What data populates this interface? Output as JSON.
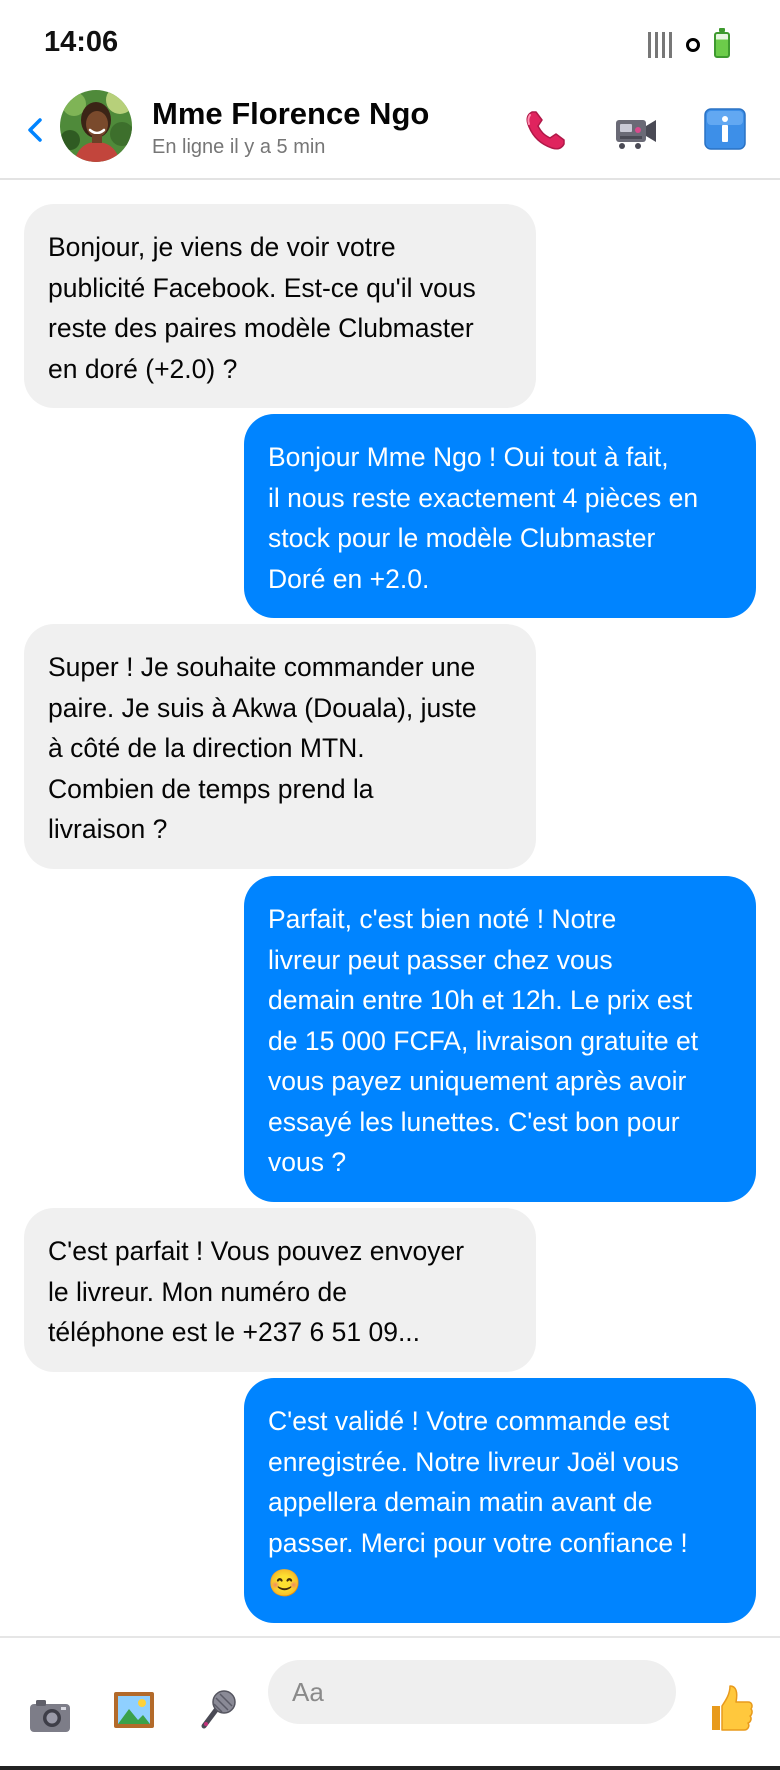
{
  "status_bar": {
    "time": "14:06",
    "icons": [
      "signal-icon",
      "wifi-icon",
      "battery-icon"
    ]
  },
  "header": {
    "back_icon": "chevron-left-icon",
    "contact_name": "Mme Florence Ngo",
    "presence": "En ligne il y a 5 min",
    "actions": [
      "phone-icon",
      "video-camera-icon",
      "info-icon"
    ]
  },
  "messages": [
    {
      "direction": "incoming",
      "text": "Bonjour, je viens de voir votre\npublicité Facebook. Est-ce qu'il vous\nreste des paires modèle Clubmaster\nen doré (+2.0) ?"
    },
    {
      "direction": "outgoing",
      "text": "Bonjour Mme Ngo ! Oui tout à fait,\nil nous reste exactement 4 pièces en\nstock pour le modèle Clubmaster\nDoré en +2.0."
    },
    {
      "direction": "incoming",
      "text": "Super ! Je souhaite commander une\npaire. Je suis à Akwa (Douala), juste\nà côté de la direction MTN.\nCombien de temps prend la\nlivraison ?"
    },
    {
      "direction": "outgoing",
      "text": "Parfait, c'est bien noté ! Notre\nlivreur peut passer chez vous\ndemain entre 10h et 12h. Le prix est\nde 15 000 FCFA, livraison gratuite et\nvous payez uniquement après avoir\nessayé les lunettes. C'est bon pour\nvous ?"
    },
    {
      "direction": "incoming",
      "text": "C'est parfait ! Vous pouvez envoyer\nle livreur. Mon numéro de\ntéléphone est le +237 6 51 09..."
    },
    {
      "direction": "outgoing",
      "text": "C'est validé ! Votre commande est\nenregistrée. Notre livreur Joël vous\nappellera demain matin avant de\npasser. Merci pour votre confiance !\n😊"
    }
  ],
  "composer": {
    "placeholder": "Aa",
    "buttons": [
      "camera-icon",
      "image-icon",
      "microphone-icon",
      "thumbs-up-icon"
    ]
  },
  "colors": {
    "outgoing_bubble": "#0084ff",
    "incoming_bubble": "#f0f0f0",
    "accent": "#0084ff"
  }
}
